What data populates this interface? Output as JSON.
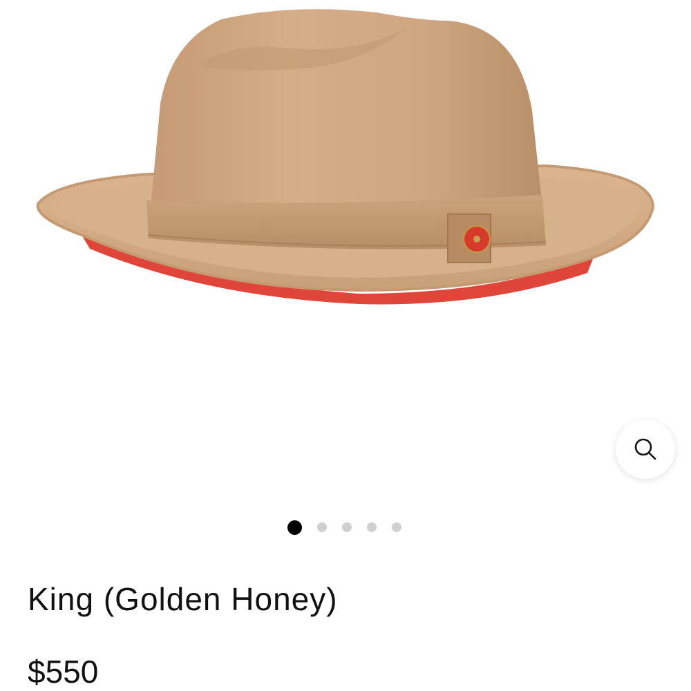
{
  "gallery": {
    "image_alt": "King (Golden Honey) fedora hat",
    "slide_count": 5,
    "active_slide": 1,
    "zoom_icon": "search-icon"
  },
  "product": {
    "title": "King (Golden Honey)",
    "price": "$550"
  },
  "colors": {
    "hat_felt": "#d2a985",
    "hat_band": "#c29a72",
    "brim_underside": "#e0453a",
    "pin": "#d83a2a",
    "dot_active": "#000000",
    "dot_inactive": "#cfcfcf"
  }
}
